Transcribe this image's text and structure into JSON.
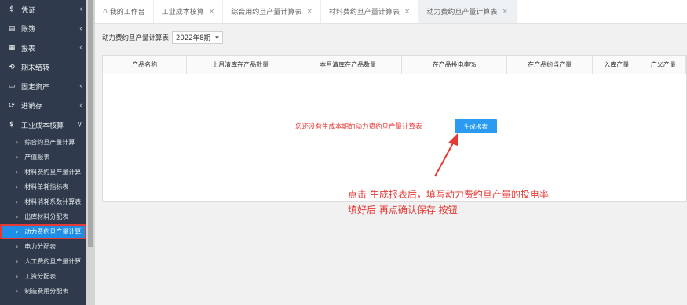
{
  "sidebar": {
    "menu": [
      {
        "icon": "$",
        "icon_name": "dollar-icon",
        "label": "凭证",
        "chevron": "‹"
      },
      {
        "icon": "▤",
        "icon_name": "ledger-icon",
        "label": "账簿",
        "chevron": "‹"
      },
      {
        "icon": "▦",
        "icon_name": "report-icon",
        "label": "报表",
        "chevron": "‹"
      },
      {
        "icon": "⟲",
        "icon_name": "period-close-icon",
        "label": "期末结转",
        "chevron": ""
      },
      {
        "icon": "▭",
        "icon_name": "fixed-asset-icon",
        "label": "固定资产",
        "chevron": "‹"
      },
      {
        "icon": "⟳",
        "icon_name": "inventory-icon",
        "label": "进销存",
        "chevron": "‹"
      },
      {
        "icon": "$",
        "icon_name": "cost-accounting-icon",
        "label": "工业成本核算",
        "chevron": "∨"
      }
    ],
    "submenu": [
      "综合约旦产量计算",
      "产值报表",
      "材料费约旦产量计算",
      "材料单耗指标表",
      "材料消耗系数计算表",
      "出库材料分配表",
      "动力费约旦产量计算",
      "电力分配表",
      "人工费约旦产量计算",
      "工资分配表",
      "制造费用分配表"
    ],
    "active_index": 6
  },
  "tabs": [
    {
      "label": "我的工作台",
      "home": true,
      "closable": false
    },
    {
      "label": "工业成本核算",
      "closable": true
    },
    {
      "label": "综合用约旦产量计算表",
      "closable": true
    },
    {
      "label": "材料费约旦产量计算表",
      "closable": true
    },
    {
      "label": "动力费约旦产量计算表",
      "closable": true,
      "active": true
    }
  ],
  "filter": {
    "label": "动力费约旦产量计算表",
    "period": "2022年8期"
  },
  "table": {
    "columns": [
      "产品名称",
      "上月清库在产品数量",
      "本月清库在产品数量",
      "在产品投电率%",
      "在产品约当产量",
      "入库产量",
      "广义产量"
    ]
  },
  "empty_message": "您还没有生成本期的动力费约旦产量计算表",
  "generate_button": "生成报表",
  "annotation": {
    "line1": "点击  生成报表后，填写动力费约旦产量的投电率",
    "line2": "填好后  再点确认保存 按钮"
  },
  "colors": {
    "sidebar_bg": "#2f3b4c",
    "active_bg": "#1e8ee6",
    "highlight_red": "#e53935",
    "button_blue": "#2a9bf0"
  }
}
